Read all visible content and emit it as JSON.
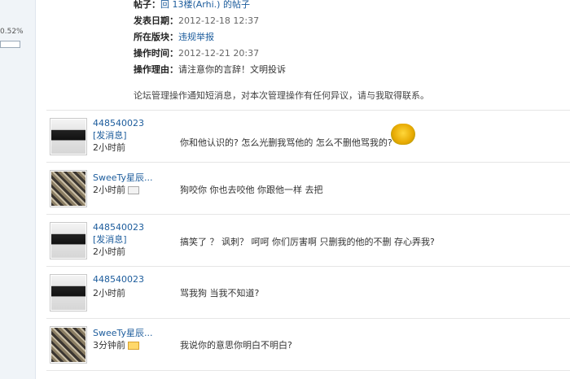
{
  "left": {
    "percent": "0.52%"
  },
  "notice": {
    "post_label": "帖子：",
    "post_value": "回 13楼(Arhi.) 的帖子",
    "date_label": "发表日期：",
    "date_value": "2012-12-18 12:37",
    "board_label": "所在版块：",
    "board_value": "违规举报",
    "optime_label": "操作时间：",
    "optime_value": "2012-12-21 20:37",
    "reason_label": "操作理由：",
    "reason_value": "请注意你的言辞！文明投诉",
    "footer": "论坛管理操作通知短消息，对本次管理操作有任何异议，请与我取得联系。"
  },
  "messages": [
    {
      "user": "448540023",
      "send": "[发消息]",
      "time": "2小时前",
      "text": "你和他认识的? 怎么光删我骂他的 怎么不删他骂我的?"
    },
    {
      "user": "SweeTy星辰...",
      "time": "2小时前",
      "text": "狗咬你 你也去咬他    你跟他一样    去把"
    },
    {
      "user": "448540023",
      "send": "[发消息]",
      "time": "2小时前",
      "text": "搞笑了 ？ 讽刺？   呵呵  你们厉害啊    只删我的他的不删 存心弄我?"
    },
    {
      "user": "448540023",
      "time": "2小时前",
      "text": "骂我狗 当我不知道?"
    },
    {
      "user": "SweeTy星辰...",
      "time": "3分钟前",
      "text": "我说你的意思你明白不明白?"
    }
  ]
}
